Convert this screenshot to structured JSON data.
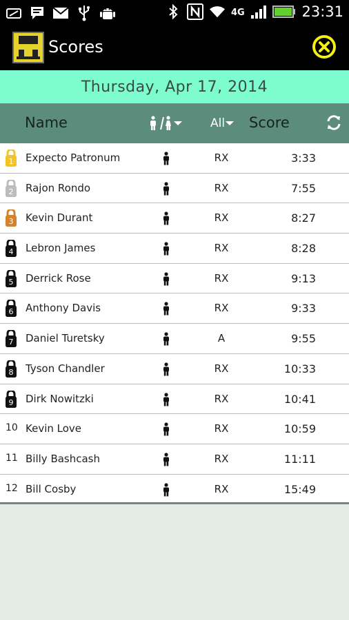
{
  "status_bar": {
    "time": "23:31",
    "left_icons": [
      "screenshot-icon",
      "message-icon",
      "mail-icon",
      "usb-icon",
      "android-debug-icon"
    ],
    "right_icons": [
      "bluetooth-icon",
      "nfc-icon",
      "wifi-icon",
      "4g-icon",
      "signal-icon",
      "battery-icon"
    ]
  },
  "action_bar": {
    "title": "Scores",
    "close_icon": "close-icon"
  },
  "date": "Thursday, Apr 17, 2014",
  "header": {
    "name": "Name",
    "gender_filter_icon": "male-female-filter-icon",
    "level_filter": "All",
    "score": "Score",
    "refresh_icon": "refresh-icon"
  },
  "colors": {
    "date_bar": "#7dfcd0",
    "header": "#5b8c7c",
    "gold": "#f6c325",
    "silver": "#bdbdbd",
    "bronze": "#d5822c",
    "black": "#111111",
    "close_yellow": "#f5ef12"
  },
  "rows": [
    {
      "rank": "1",
      "medal": "gold",
      "name": "Expecto Patronum",
      "gender": "male",
      "level": "RX",
      "score": "3:33"
    },
    {
      "rank": "2",
      "medal": "silver",
      "name": "Rajon Rondo",
      "gender": "male",
      "level": "RX",
      "score": "7:55"
    },
    {
      "rank": "3",
      "medal": "bronze",
      "name": "Kevin Durant",
      "gender": "male",
      "level": "RX",
      "score": "8:27"
    },
    {
      "rank": "4",
      "medal": "black",
      "name": "Lebron James",
      "gender": "male",
      "level": "RX",
      "score": "8:28"
    },
    {
      "rank": "5",
      "medal": "black",
      "name": "Derrick Rose",
      "gender": "male",
      "level": "RX",
      "score": "9:13"
    },
    {
      "rank": "6",
      "medal": "black",
      "name": "Anthony Davis",
      "gender": "male",
      "level": "RX",
      "score": "9:33"
    },
    {
      "rank": "7",
      "medal": "black",
      "name": "Daniel Turetsky",
      "gender": "male",
      "level": "A",
      "score": "9:55"
    },
    {
      "rank": "8",
      "medal": "black",
      "name": "Tyson Chandler",
      "gender": "male",
      "level": "RX",
      "score": "10:33"
    },
    {
      "rank": "9",
      "medal": "black",
      "name": "Dirk Nowitzki",
      "gender": "male",
      "level": "RX",
      "score": "10:41"
    },
    {
      "rank": "10",
      "medal": "none",
      "name": "Kevin Love",
      "gender": "male",
      "level": "RX",
      "score": "10:59"
    },
    {
      "rank": "11",
      "medal": "none",
      "name": "Billy Bashcash",
      "gender": "male",
      "level": "RX",
      "score": "11:11"
    },
    {
      "rank": "12",
      "medal": "none",
      "name": "Bill Cosby",
      "gender": "male",
      "level": "RX",
      "score": "15:49"
    }
  ]
}
